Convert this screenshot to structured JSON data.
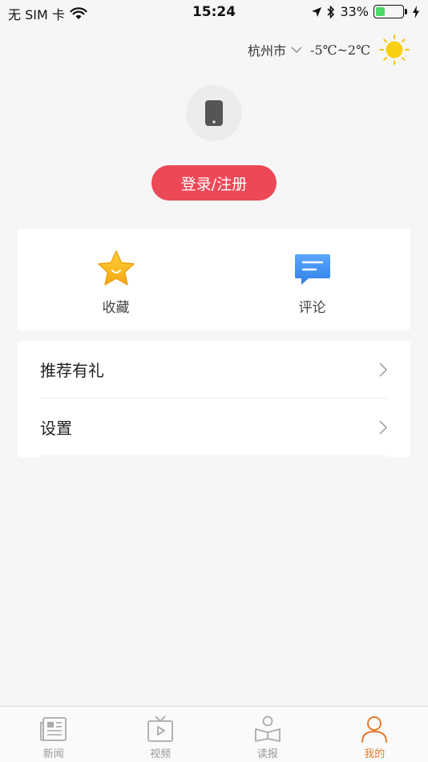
{
  "status_bar": {
    "carrier": "无 SIM 卡",
    "time": "15:24",
    "battery": "33%",
    "battery_level": 0.33
  },
  "header": {
    "city": "杭州市",
    "temperature": "-5℃~2℃",
    "weather_icon": "sun-icon"
  },
  "profile": {
    "avatar_icon": "phone-icon",
    "login_label": "登录/注册"
  },
  "actions": [
    {
      "label": "收藏",
      "icon": "star-icon"
    },
    {
      "label": "评论",
      "icon": "comment-icon"
    }
  ],
  "menu": [
    {
      "label": "推荐有礼"
    },
    {
      "label": "设置"
    }
  ],
  "tabs": [
    {
      "label": "新闻",
      "icon": "newspaper-icon",
      "active": false
    },
    {
      "label": "视频",
      "icon": "tv-icon",
      "active": false
    },
    {
      "label": "读报",
      "icon": "reader-icon",
      "active": false
    },
    {
      "label": "我的",
      "icon": "user-icon",
      "active": true
    }
  ],
  "colors": {
    "accent": "#ec4856",
    "active_tab": "#e8792a",
    "inactive_tab": "#999999",
    "background": "#f6f6f6"
  }
}
